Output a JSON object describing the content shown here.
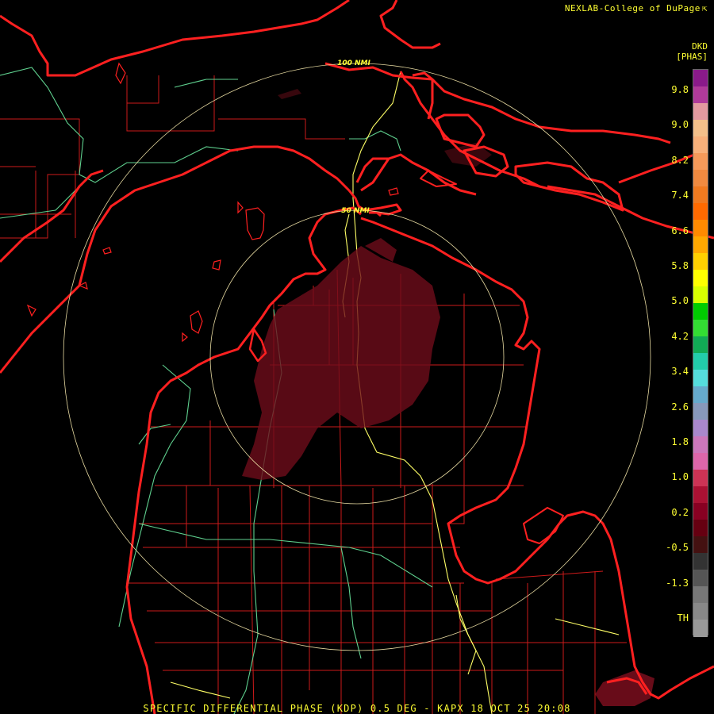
{
  "header": {
    "credit": "NEXLAB-College of DuPage",
    "credit_mark": "⇱"
  },
  "legend": {
    "product": "DKD",
    "units": "[PHAS]",
    "labels": [
      "9.8",
      "9.0",
      "8.2",
      "7.4",
      "6.6",
      "5.8",
      "5.0",
      "4.2",
      "3.4",
      "2.6",
      "1.8",
      "1.0",
      "0.2",
      "-0.5",
      "-1.3",
      "TH"
    ],
    "colors": [
      "#8a1a8a",
      "#b03a9a",
      "#e39aa0",
      "#f3c08a",
      "#f7b07a",
      "#f59a5a",
      "#f08a40",
      "#f07a20",
      "#ff6a00",
      "#ff8a00",
      "#ffa800",
      "#ffd000",
      "#ffff00",
      "#d8ff00",
      "#00cc00",
      "#33dd33",
      "#11aa55",
      "#22ccaa",
      "#55dddd",
      "#66aacc",
      "#8899bb",
      "#aa88cc",
      "#cc77bb",
      "#dd66aa",
      "#cc3355",
      "#aa1133",
      "#880022",
      "#660011",
      "#441111",
      "#333333",
      "#555555",
      "#777777",
      "#888888",
      "#999999"
    ]
  },
  "rings": {
    "labels": [
      "100 NMI",
      "50 NMI"
    ]
  },
  "footer": {
    "caption": "SPECIFIC DIFFERENTIAL PHASE (KDP) 0.5 DEG - KAPX 18 OCT 25 20:08"
  },
  "style": {
    "background": "#000000",
    "coast": "#ff2020",
    "county": "#cc1a1a",
    "road_green": "#5fd18f",
    "road_yellow": "#ffff66",
    "ring": "#e6d9a0",
    "echo": "#6e0d1a"
  }
}
